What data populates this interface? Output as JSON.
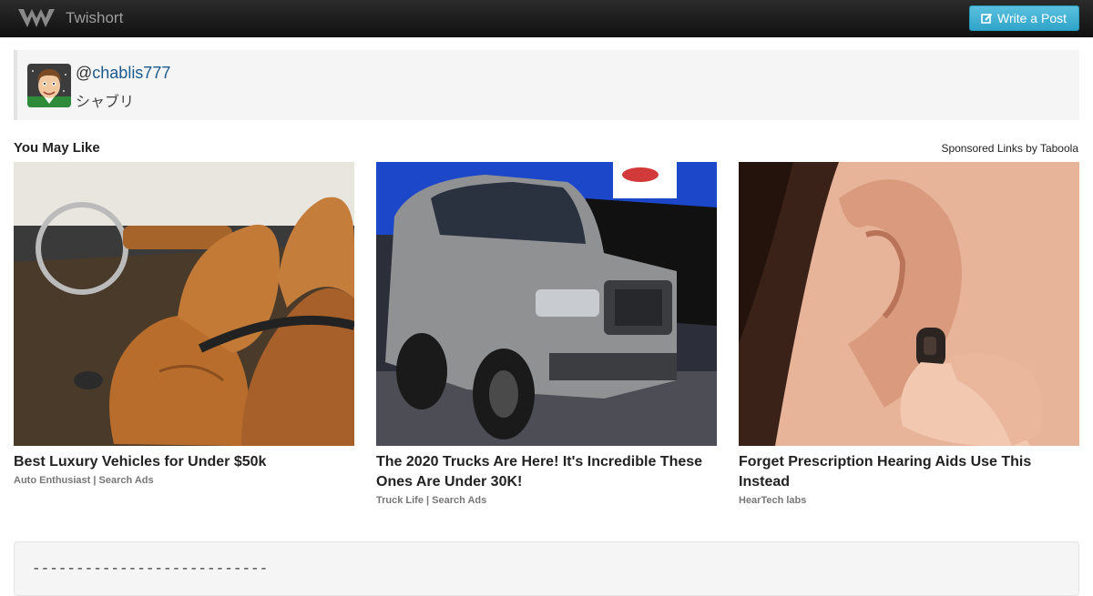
{
  "navbar": {
    "brand": "Twishort",
    "logo_icon": "twishort-logo-icon",
    "write_button": "Write a Post",
    "write_icon": "edit-icon"
  },
  "profile": {
    "at": "@",
    "handle": "chablis777",
    "display_name": "シャブリ"
  },
  "recommendations": {
    "heading": "You May Like",
    "sponsored": "Sponsored Links by Taboola",
    "items": [
      {
        "title": "Best Luxury Vehicles for Under $50k",
        "source": "Auto Enthusiast | Search Ads"
      },
      {
        "title": "The 2020 Trucks Are Here! It's Incredible These Ones Are Under 30K!",
        "source": "Truck Life | Search Ads"
      },
      {
        "title": "Forget Prescription Hearing Aids Use This Instead",
        "source": "HearTech labs"
      }
    ]
  },
  "post": {
    "text": "---------------------------"
  }
}
